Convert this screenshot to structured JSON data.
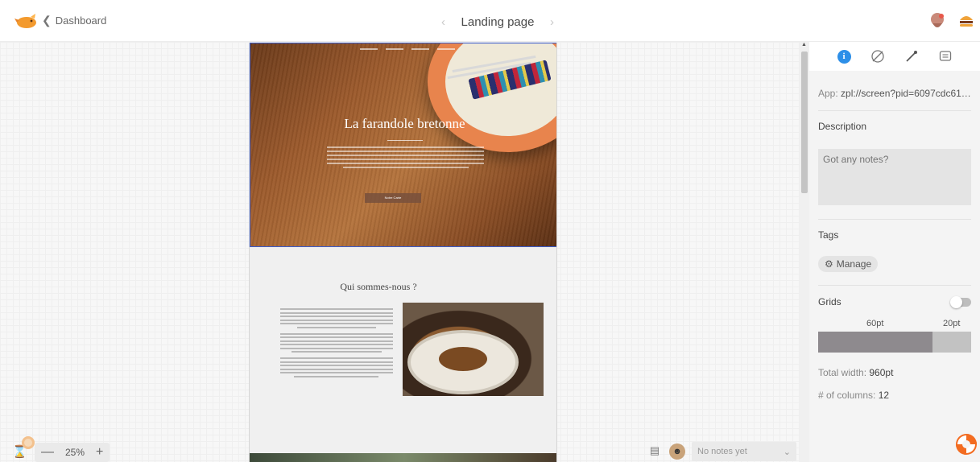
{
  "header": {
    "back_label": "Dashboard",
    "screen_title": "Landing page",
    "prev_arrow": "‹",
    "next_arrow": "›"
  },
  "artboard": {
    "hero_title": "La farandole bretonne",
    "hero_button": "Notre Carte",
    "about_title": "Qui sommes-nous ?"
  },
  "zoom": {
    "value": "25%",
    "minus": "—",
    "plus": "+"
  },
  "notes_bar": {
    "select_value": "No notes yet"
  },
  "panel": {
    "app_label": "App:",
    "app_value": "zpl://screen?pid=6097cdc61…",
    "description_label": "Description",
    "notes_placeholder": "Got any notes?",
    "tags_label": "Tags",
    "manage_label": "Manage",
    "grids_label": "Grids",
    "grids_enabled": false,
    "grid_column": "60pt",
    "grid_gutter": "20pt",
    "total_width_label": "Total width:",
    "total_width_value": "960pt",
    "columns_label": "# of columns:",
    "columns_value": "12"
  },
  "icons": {
    "logo": "zeplin-logo-icon",
    "back": "chevron-left-icon",
    "info_tab": "info-icon",
    "styleguide_tab": "styleguide-icon",
    "color_tab": "eyedropper-icon",
    "notes_tab": "comment-icon",
    "help": "lifebuoy-icon"
  },
  "colors": {
    "accent": "#2d8fe8",
    "help": "#f36c21",
    "logo": "#f39a2e"
  }
}
